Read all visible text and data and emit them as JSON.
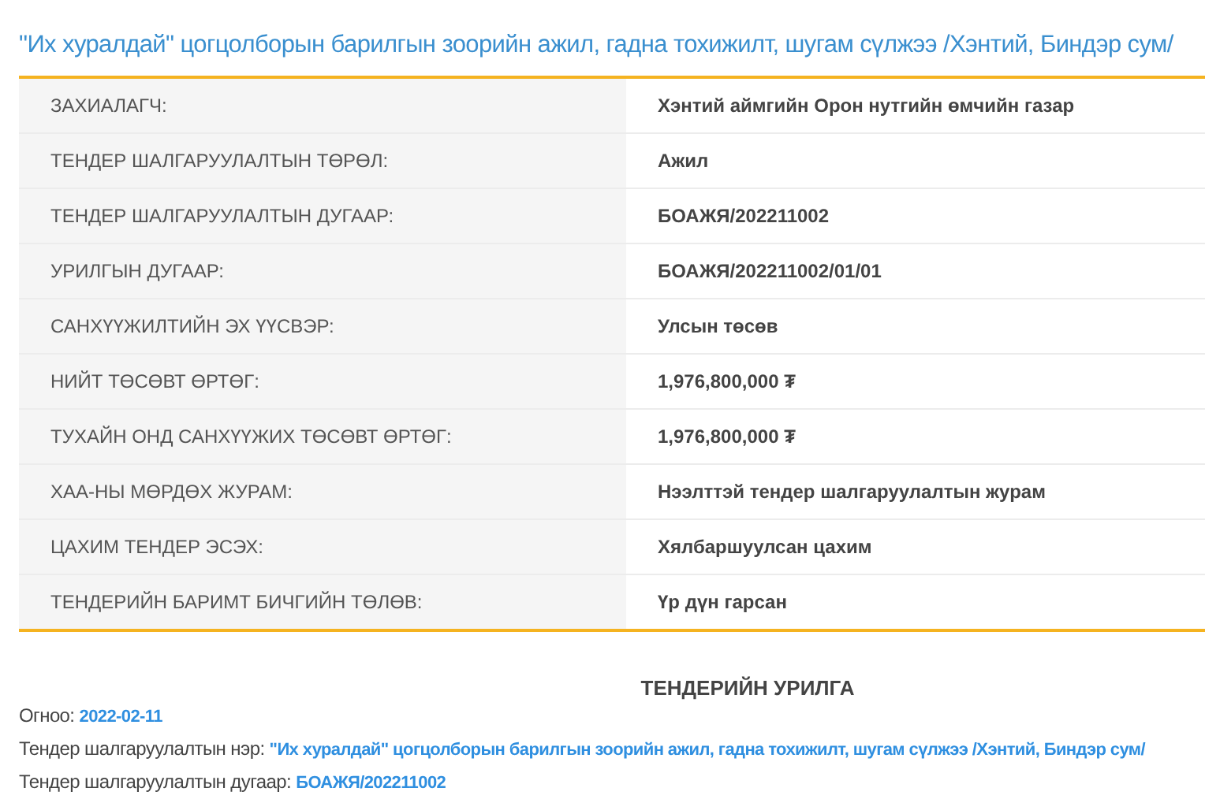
{
  "title": "\"Их хуралдай\" цогцолборын барилгын зоорийн ажил, гадна тохижилт, шугам сүлжээ /Хэнтий, Биндэр сум/",
  "details": [
    {
      "label": "ЗАХИАЛАГЧ:",
      "value": "Хэнтий аймгийн Орон нутгийн өмчийн газар"
    },
    {
      "label": "ТЕНДЕР ШАЛГАРУУЛАЛТЫН ТӨРӨЛ:",
      "value": "Ажил"
    },
    {
      "label": "ТЕНДЕР ШАЛГАРУУЛАЛТЫН ДУГААР:",
      "value": "БОАЖЯ/202211002"
    },
    {
      "label": "УРИЛГЫН ДУГААР:",
      "value": "БОАЖЯ/202211002/01/01"
    },
    {
      "label": "САНХҮҮЖИЛТИЙН ЭХ ҮҮСВЭР:",
      "value": "Улсын төсөв"
    },
    {
      "label": "НИЙТ ТӨСӨВТ ӨРТӨГ:",
      "value": "1,976,800,000 ₮"
    },
    {
      "label": "ТУХАЙН ОНД САНХҮҮЖИХ ТӨСӨВТ ӨРТӨГ:",
      "value": "1,976,800,000 ₮"
    },
    {
      "label": "ХАА-НЫ МӨРДӨХ ЖУРАМ:",
      "value": "Нээлттэй тендер шалгаруулалтын журам"
    },
    {
      "label": "ЦАХИМ ТЕНДЕР ЭСЭХ:",
      "value": "Хялбаршуулсан цахим"
    },
    {
      "label": "ТЕНДЕРИЙН БАРИМТ БИЧГИЙН ТӨЛӨВ:",
      "value": "Үр дүн гарсан"
    }
  ],
  "invitation": {
    "heading": "ТЕНДЕРИЙН УРИЛГА",
    "lines": [
      {
        "label": "Огноо:",
        "value": "2022-02-11"
      },
      {
        "label": "Тендер шалгаруулалтын нэр:",
        "value": "\"Их хуралдай\" цогцолборын барилгын зоорийн ажил, гадна тохижилт, шугам сүлжээ /Хэнтий, Биндэр сум/"
      },
      {
        "label": "Тендер шалгаруулалтын дугаар:",
        "value": "БОАЖЯ/202211002"
      }
    ]
  }
}
